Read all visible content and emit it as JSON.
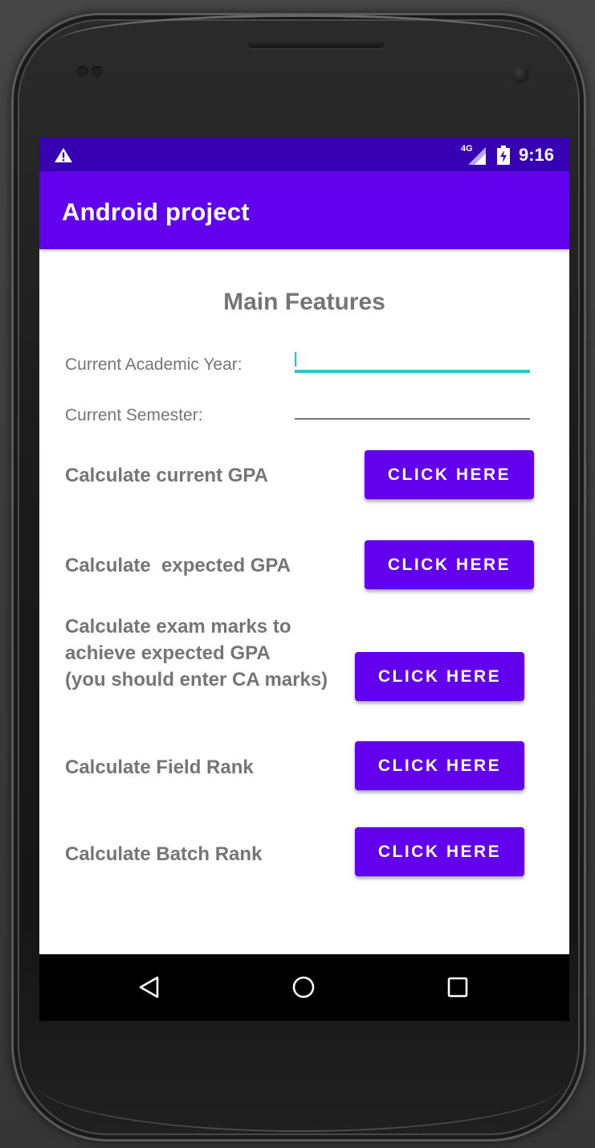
{
  "status_bar": {
    "network_label": "4G",
    "time": "9:16",
    "icons": [
      "warning-icon",
      "signal-icon",
      "battery-icon"
    ],
    "color": "#3700b3"
  },
  "app_bar": {
    "title": "Android project",
    "color": "#6200ee"
  },
  "main": {
    "heading": "Main Features",
    "fields": [
      {
        "label": "Current Academic Year:",
        "value": "",
        "focused": true
      },
      {
        "label": "Current Semester:",
        "value": "",
        "focused": false
      }
    ],
    "features": [
      {
        "label": "Calculate current GPA",
        "button": "CLICK HERE"
      },
      {
        "label": "Calculate  expected GPA",
        "button": "CLICK HERE"
      },
      {
        "label_lines": [
          "Calculate exam marks to",
          "achieve expected GPA",
          "(you should enter CA marks)"
        ],
        "button": "CLICK HERE"
      },
      {
        "label": "Calculate Field Rank",
        "button": "CLICK HERE"
      },
      {
        "label": "Calculate Batch Rank",
        "button": "CLICK HERE"
      }
    ],
    "button_color": "#6200ee",
    "focus_color": "#26c6c6"
  },
  "nav_bar": {
    "icons": [
      "back-icon",
      "home-icon",
      "recents-icon"
    ]
  }
}
